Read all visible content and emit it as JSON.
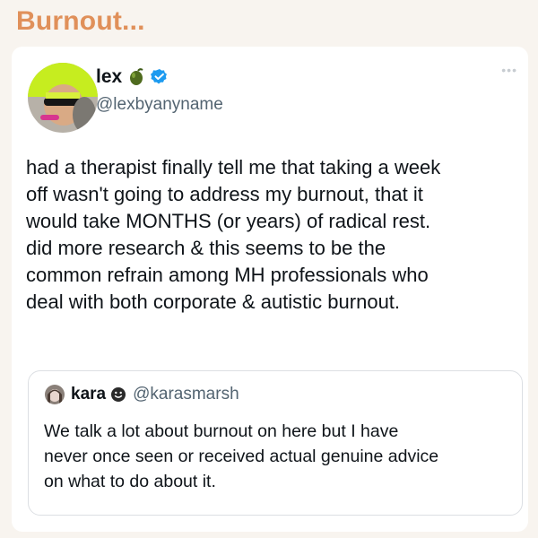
{
  "header": {
    "title": "Burnout...",
    "title_color": "#e0905a"
  },
  "tweet": {
    "display_name": "lex",
    "name_emoji_icon": "olive-icon",
    "verified_icon": "verified-badge-icon",
    "handle": "@lexbyanyname",
    "more_icon": "more-options-icon",
    "body": "had a therapist finally tell me that taking a week\noff wasn't going to address my burnout, that it\nwould take MONTHS (or years) of radical rest.\ndid more research & this seems to be the\ncommon refrain among MH professionals who\ndeal with both corporate & autistic burnout."
  },
  "quoted_tweet": {
    "display_name": "kara",
    "badge_icon": "smiley-badge-icon",
    "handle": "@karasmarsh",
    "body": "We talk a lot about burnout on here but I have\nnever once seen or received actual genuine advice\non what to do about it."
  },
  "colors": {
    "page_background": "#f8f4ef",
    "card_background": "#ffffff",
    "verified_blue": "#1d9bf0",
    "secondary_text": "#536471"
  }
}
